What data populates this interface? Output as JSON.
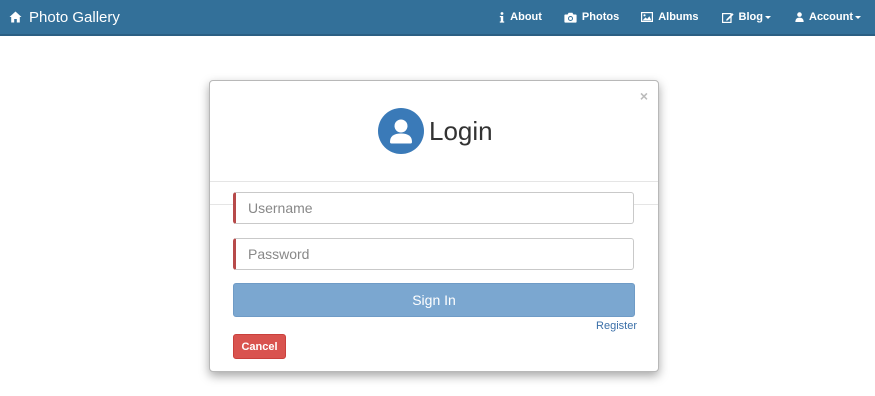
{
  "navbar": {
    "brand": "Photo Gallery",
    "brand_icon": "home-icon",
    "items": [
      {
        "label": "About",
        "icon": "info-icon"
      },
      {
        "label": "Photos",
        "icon": "camera-icon"
      },
      {
        "label": "Albums",
        "icon": "picture-icon"
      },
      {
        "label": "Blog",
        "icon": "edit-icon",
        "dropdown": true
      },
      {
        "label": "Account",
        "icon": "user-icon",
        "dropdown": true
      }
    ]
  },
  "modal": {
    "title": "Login",
    "close": "×",
    "avatar_icon": "user-circle-icon",
    "username_placeholder": "Username",
    "username_value": "",
    "password_placeholder": "Password",
    "password_value": "",
    "signin_label": "Sign In",
    "register_label": "Register",
    "cancel_label": "Cancel"
  },
  "colors": {
    "navbar": "#337099",
    "primary_button": "#7ba7d0",
    "danger_button": "#d9534f",
    "avatar": "#3a7ab8",
    "field_accent": "#b74a4a"
  }
}
